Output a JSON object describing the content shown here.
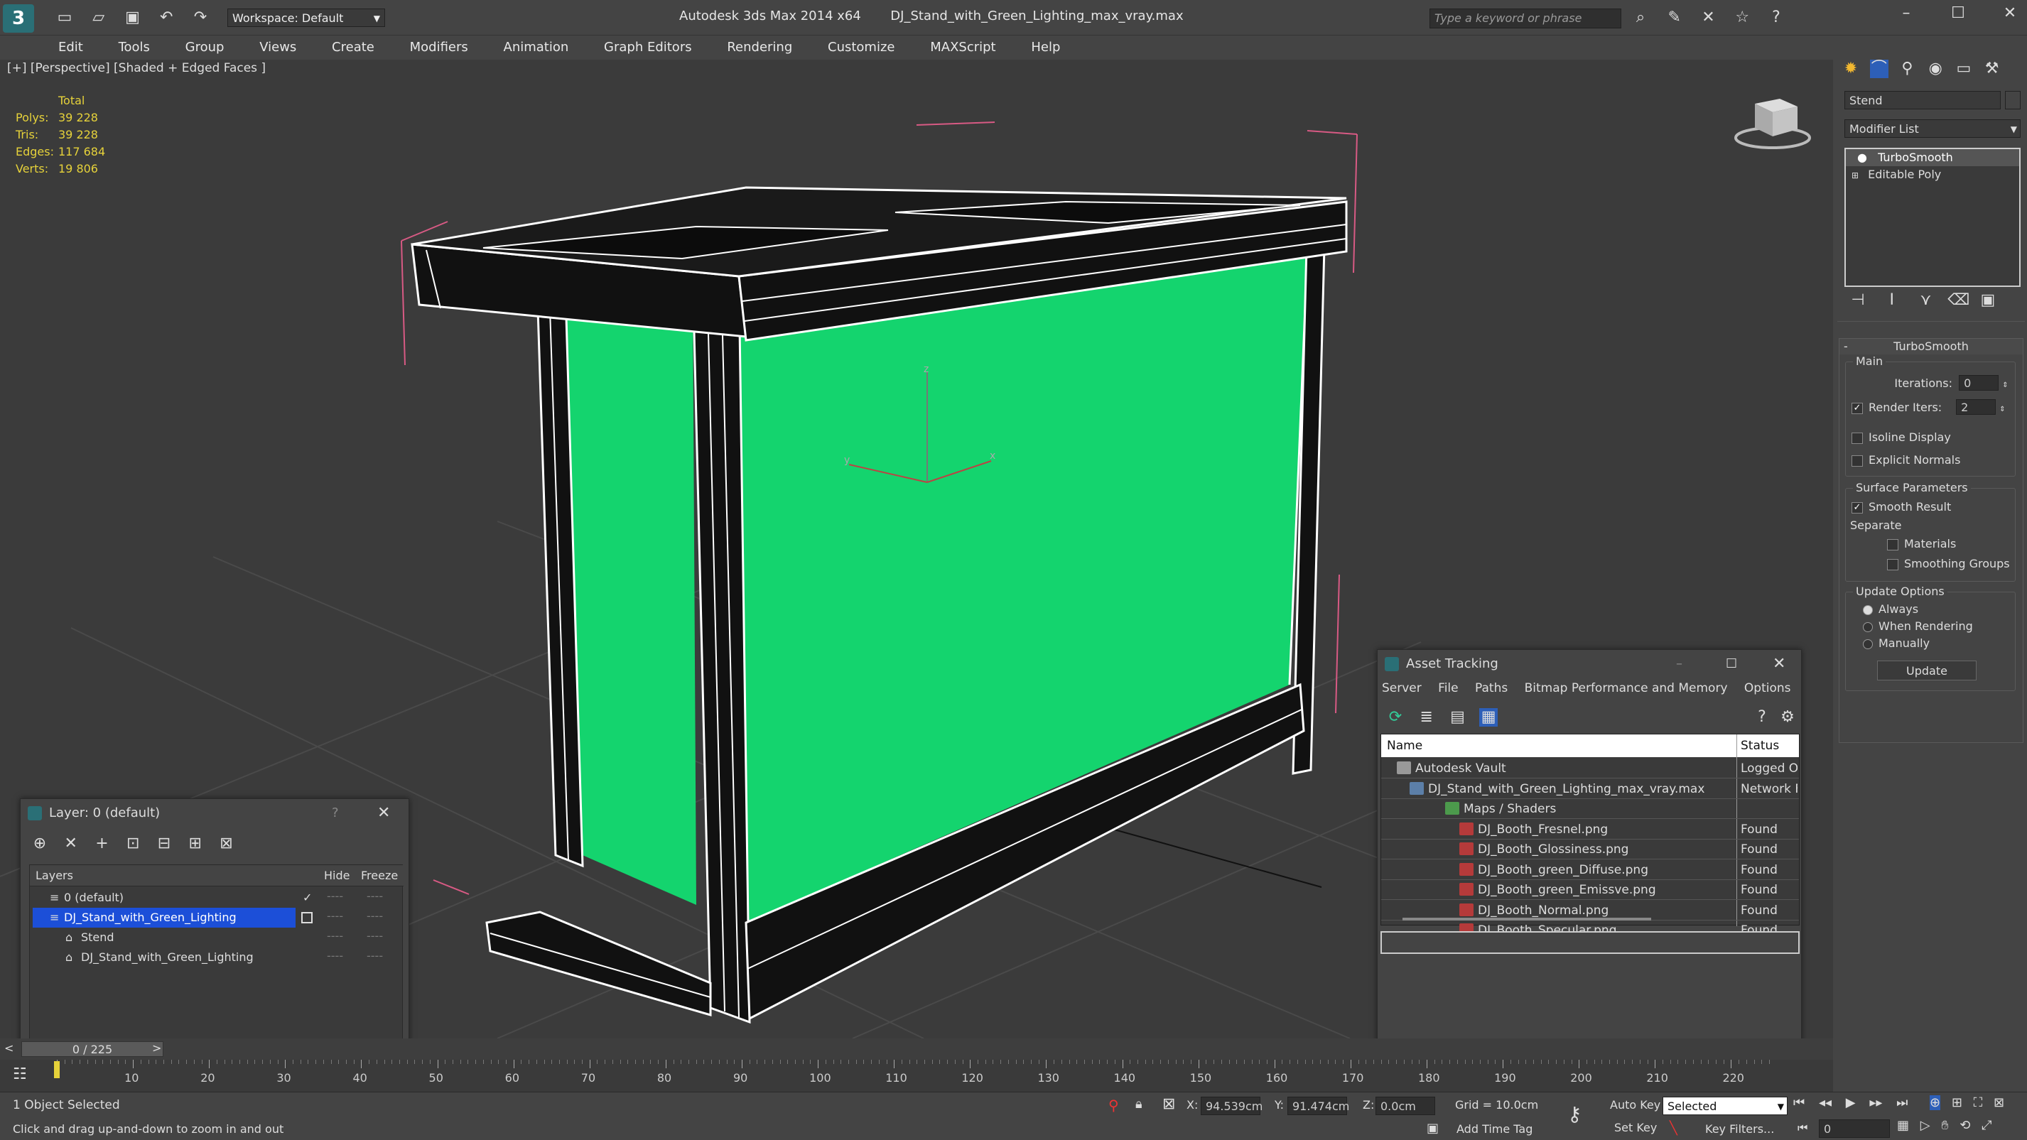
{
  "titlebar": {
    "workspace_label": "Workspace: Default",
    "app_title": "Autodesk 3ds Max  2014 x64",
    "file_title": "DJ_Stand_with_Green_Lighting_max_vray.max",
    "search_placeholder": "Type a keyword or phrase"
  },
  "menu": [
    "Edit",
    "Tools",
    "Group",
    "Views",
    "Create",
    "Modifiers",
    "Animation",
    "Graph Editors",
    "Rendering",
    "Customize",
    "MAXScript",
    "Help"
  ],
  "viewport": {
    "label": "[+] [Perspective] [Shaded + Edged Faces ]",
    "stats": {
      "header": "Total",
      "polys_label": "Polys:",
      "polys": "39 228",
      "tris_label": "Tris:",
      "tris": "39 228",
      "edges_label": "Edges:",
      "edges": "117 684",
      "verts_label": "Verts:",
      "verts": "19 806"
    },
    "gizmo": {
      "x": "x",
      "y": "y",
      "z": "z"
    },
    "accent_green": "#14d46e"
  },
  "layer_window": {
    "title": "Layer: 0 (default)",
    "help": "?",
    "columns": {
      "layers": "Layers",
      "hide": "Hide",
      "freeze": "Freeze"
    },
    "rows": [
      {
        "name": "0 (default)",
        "hide": "----",
        "freeze": "----"
      },
      {
        "name": "DJ_Stand_with_Green_Lighting",
        "hide": "----",
        "freeze": "----"
      },
      {
        "name": "Stend",
        "hide": "----",
        "freeze": "----"
      },
      {
        "name": "DJ_Stand_with_Green_Lighting",
        "hide": "----",
        "freeze": "----"
      }
    ]
  },
  "asset_window": {
    "title": "Asset Tracking",
    "menu": [
      "Server",
      "File",
      "Paths",
      "Bitmap Performance and Memory",
      "Options"
    ],
    "columns": {
      "name": "Name",
      "status": "Status"
    },
    "rows": [
      {
        "name": "Autodesk Vault",
        "status": "Logged O"
      },
      {
        "name": "DJ_Stand_with_Green_Lighting_max_vray.max",
        "status": "Network F"
      },
      {
        "name": "Maps / Shaders",
        "status": ""
      },
      {
        "name": "DJ_Booth_Fresnel.png",
        "status": "Found"
      },
      {
        "name": "DJ_Booth_Glossiness.png",
        "status": "Found"
      },
      {
        "name": "DJ_Booth_green_Diffuse.png",
        "status": "Found"
      },
      {
        "name": "DJ_Booth_green_Emissve.png",
        "status": "Found"
      },
      {
        "name": "DJ_Booth_Normal.png",
        "status": "Found"
      },
      {
        "name": "DJ_Booth_Specular.png",
        "status": "Found"
      }
    ]
  },
  "command_panel": {
    "object_name": "Stend",
    "modifier_list": "Modifier List",
    "stack": [
      "TurboSmooth",
      "Editable Poly"
    ],
    "rollout_title": "TurboSmooth",
    "main_group": "Main",
    "iterations_label": "Iterations:",
    "iterations": "0",
    "render_iters_label": "Render Iters:",
    "render_iters": "2",
    "isoline_label": "Isoline Display",
    "explicit_label": "Explicit Normals",
    "surface_group": "Surface Parameters",
    "smooth_result_label": "Smooth Result",
    "separate_label": "Separate",
    "materials_label": "Materials",
    "smoothing_groups_label": "Smoothing Groups",
    "update_group": "Update Options",
    "always_label": "Always",
    "when_rendering_label": "When Rendering",
    "manually_label": "Manually",
    "update_button": "Update"
  },
  "timeline": {
    "frame_counter": "0 / 225",
    "ticks": [
      "0",
      "10",
      "20",
      "30",
      "40",
      "50",
      "60",
      "70",
      "80",
      "90",
      "100",
      "110",
      "120",
      "130",
      "140",
      "150",
      "160",
      "170",
      "180",
      "190",
      "200",
      "210",
      "220"
    ]
  },
  "status": {
    "selection": "1 Object Selected",
    "prompt": "Click and drag up-and-down to zoom in and out",
    "x_label": "X:",
    "x_value": "94.539cm",
    "y_label": "Y:",
    "y_value": "91.474cm",
    "z_label": "Z:",
    "z_value": "0.0cm",
    "grid": "Grid = 10.0cm",
    "add_time_tag": "Add Time Tag",
    "auto_key": "Auto Key",
    "set_key": "Set Key",
    "selected_option": "Selected",
    "key_filters": "Key Filters...",
    "frame_field": "0"
  }
}
